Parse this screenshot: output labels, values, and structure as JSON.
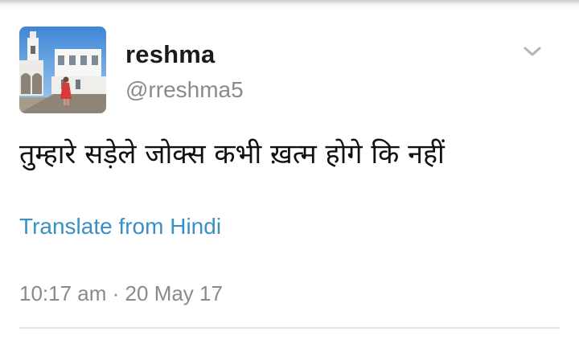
{
  "tweet": {
    "author": {
      "display_name": "reshma",
      "handle": "@rreshma5",
      "avatar_icon": "profile-photo"
    },
    "menu_icon": "chevron-down-icon",
    "text": "तुम्हारे सड़ेले जोक्स कभी ख़त्म होगे कि नहीं",
    "translate_label": "Translate from Hindi",
    "time": "10:17 am",
    "separator": "·",
    "date": "20 May 17"
  },
  "colors": {
    "link": "#3b8fc7",
    "muted": "#8a8a8a",
    "text": "#111111"
  }
}
